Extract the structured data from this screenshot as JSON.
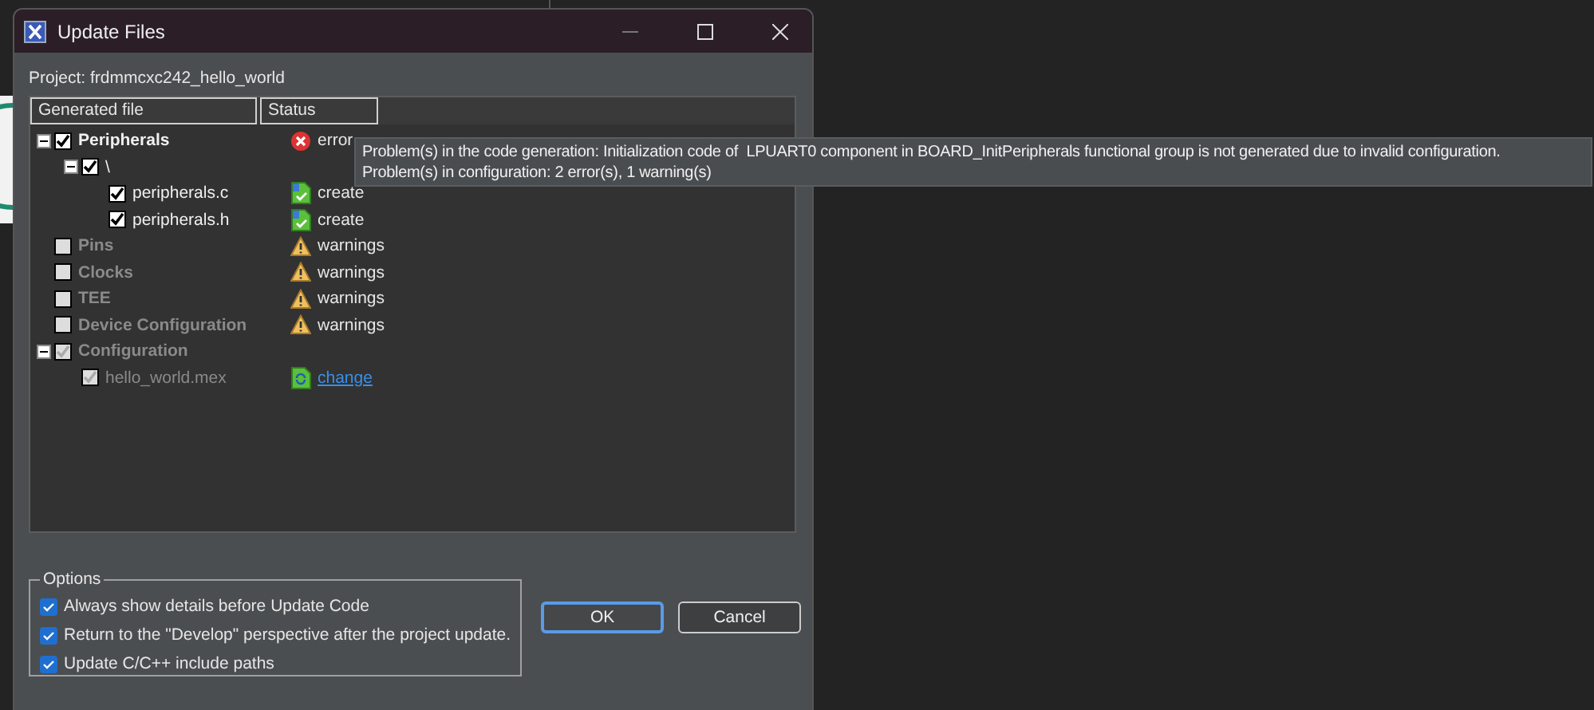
{
  "window": {
    "title": "Update Files"
  },
  "project_label": "Project: frdmmcxc242_hello_world",
  "table": {
    "columns": [
      "Generated file",
      "Status"
    ]
  },
  "tree": {
    "items": [
      {
        "label": "Peripherals",
        "checked": true,
        "disabled": false,
        "expanded": true,
        "status": {
          "kind": "error",
          "text": "error"
        },
        "children": [
          {
            "label": "\\",
            "checked": true,
            "disabled": false,
            "expanded": true,
            "children": [
              {
                "label": "peripherals.c",
                "checked": true,
                "disabled": false,
                "status": {
                  "kind": "create",
                  "text": "create"
                }
              },
              {
                "label": "peripherals.h",
                "checked": true,
                "disabled": false,
                "status": {
                  "kind": "create",
                  "text": "create"
                }
              }
            ]
          }
        ]
      },
      {
        "label": "Pins",
        "checked": false,
        "disabled": true,
        "status": {
          "kind": "warning",
          "text": "warnings"
        }
      },
      {
        "label": "Clocks",
        "checked": false,
        "disabled": true,
        "status": {
          "kind": "warning",
          "text": "warnings"
        }
      },
      {
        "label": "TEE",
        "checked": false,
        "disabled": true,
        "status": {
          "kind": "warning",
          "text": "warnings"
        }
      },
      {
        "label": "Device Configuration",
        "checked": false,
        "disabled": true,
        "status": {
          "kind": "warning",
          "text": "warnings"
        }
      },
      {
        "label": "Configuration",
        "checked": true,
        "disabled": true,
        "expanded": true,
        "children": [
          {
            "label": "hello_world.mex",
            "checked": true,
            "disabled": true,
            "status": {
              "kind": "change",
              "text": "change"
            }
          }
        ]
      }
    ]
  },
  "tooltip": [
    "Problem(s) in the code generation: Initialization code of  LPUART0 component in BOARD_InitPeripherals functional group is not generated due to invalid configuration.",
    "Problem(s) in configuration: 2 error(s), 1 warning(s)"
  ],
  "options": {
    "title": "Options",
    "items": [
      {
        "label": "Always show details before Update Code",
        "checked": true
      },
      {
        "label": "Return to the \"Develop\" perspective after the project update.",
        "checked": true
      },
      {
        "label": "Update C/C++ include paths",
        "checked": true
      }
    ]
  },
  "buttons": [
    {
      "label": "OK",
      "default": true
    },
    {
      "label": "Cancel",
      "default": false
    }
  ]
}
